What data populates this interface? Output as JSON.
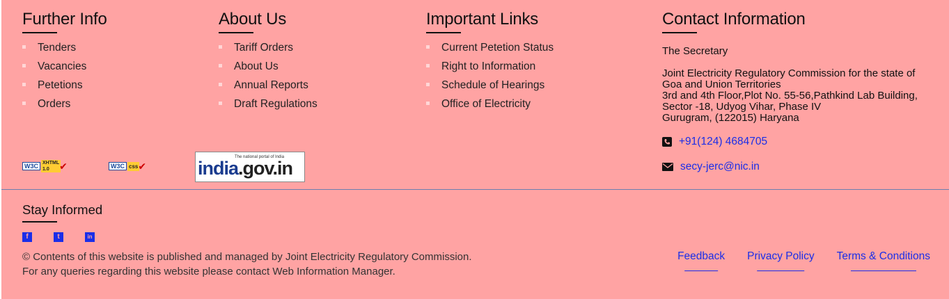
{
  "further_info": {
    "title": "Further Info",
    "items": [
      "Tenders",
      "Vacancies",
      "Petetions",
      "Orders"
    ]
  },
  "about_us": {
    "title": "About Us",
    "items": [
      "Tariff Orders",
      "About Us",
      "Annual Reports",
      "Draft Regulations"
    ]
  },
  "important_links": {
    "title": "Important Links",
    "items": [
      "Current Petetion Status",
      "Right to Information",
      "Schedule of Hearings",
      "Office of Electricity"
    ]
  },
  "contact": {
    "title": "Contact Information",
    "secretary": "The Secretary",
    "address_lines": [
      "Joint Electricity Regulatory Commission for the state of",
      "Goa and Union Territories",
      "3rd and 4th Floor,Plot No. 55-56,Pathkind Lab Building,",
      "Sector -18, Udyog Vihar, Phase IV",
      "Gurugram, (122015) Haryana"
    ],
    "phone": "+91(124) 4684705",
    "email": "secy-jerc@nic.in",
    "phone_icon": "phone-icon",
    "email_icon": "envelope-icon"
  },
  "badges": {
    "xhtml": {
      "w3c": "W3C",
      "label": "XHTML",
      "version": "1.0"
    },
    "css": {
      "w3c": "W3C",
      "label": "css"
    },
    "india_portal": {
      "tagline": "The national portal of India",
      "logo_a": "india",
      "logo_b": ".gov.in"
    }
  },
  "stay_informed": {
    "title": "Stay Informed",
    "social": [
      {
        "icon": "facebook-icon",
        "glyph": "f"
      },
      {
        "icon": "twitter-icon",
        "glyph": "t"
      },
      {
        "icon": "linkedin-icon",
        "glyph": "in"
      }
    ]
  },
  "copyright": {
    "line1": "© Contents of this website is published and managed by Joint Electricity Regulatory Commission.",
    "line2": "For any queries regarding this website please contact Web Information Manager."
  },
  "bottom_links": [
    "Feedback",
    "Privacy Policy",
    "Terms & Conditions"
  ],
  "colors": {
    "background": "#ffa3a3",
    "link": "#1a2ee8"
  }
}
